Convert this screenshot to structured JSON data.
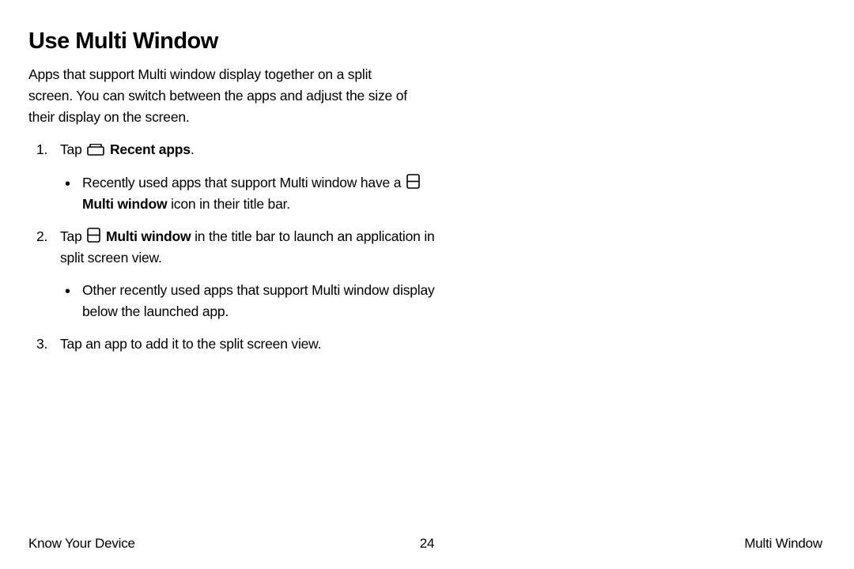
{
  "title": "Use Multi Window",
  "intro": "Apps that support Multi window display together on a split screen. You can switch between the apps and adjust the size of their display on the screen.",
  "steps": {
    "s1": {
      "pre": "Tap",
      "label": "Recent apps",
      "post": ".",
      "bullet": {
        "pre": "Recently used apps that support Multi window have a",
        "label": "Multi window",
        "post": "icon in their title bar."
      }
    },
    "s2": {
      "pre": "Tap",
      "label": "Multi window",
      "post": "in the title bar to launch an application in split screen view.",
      "bullet": "Other recently used apps that support Multi window display below the launched app."
    },
    "s3": "Tap an app to add it to the split screen view."
  },
  "footer": {
    "left": "Know Your Device",
    "page": "24",
    "right": "Multi Window"
  }
}
